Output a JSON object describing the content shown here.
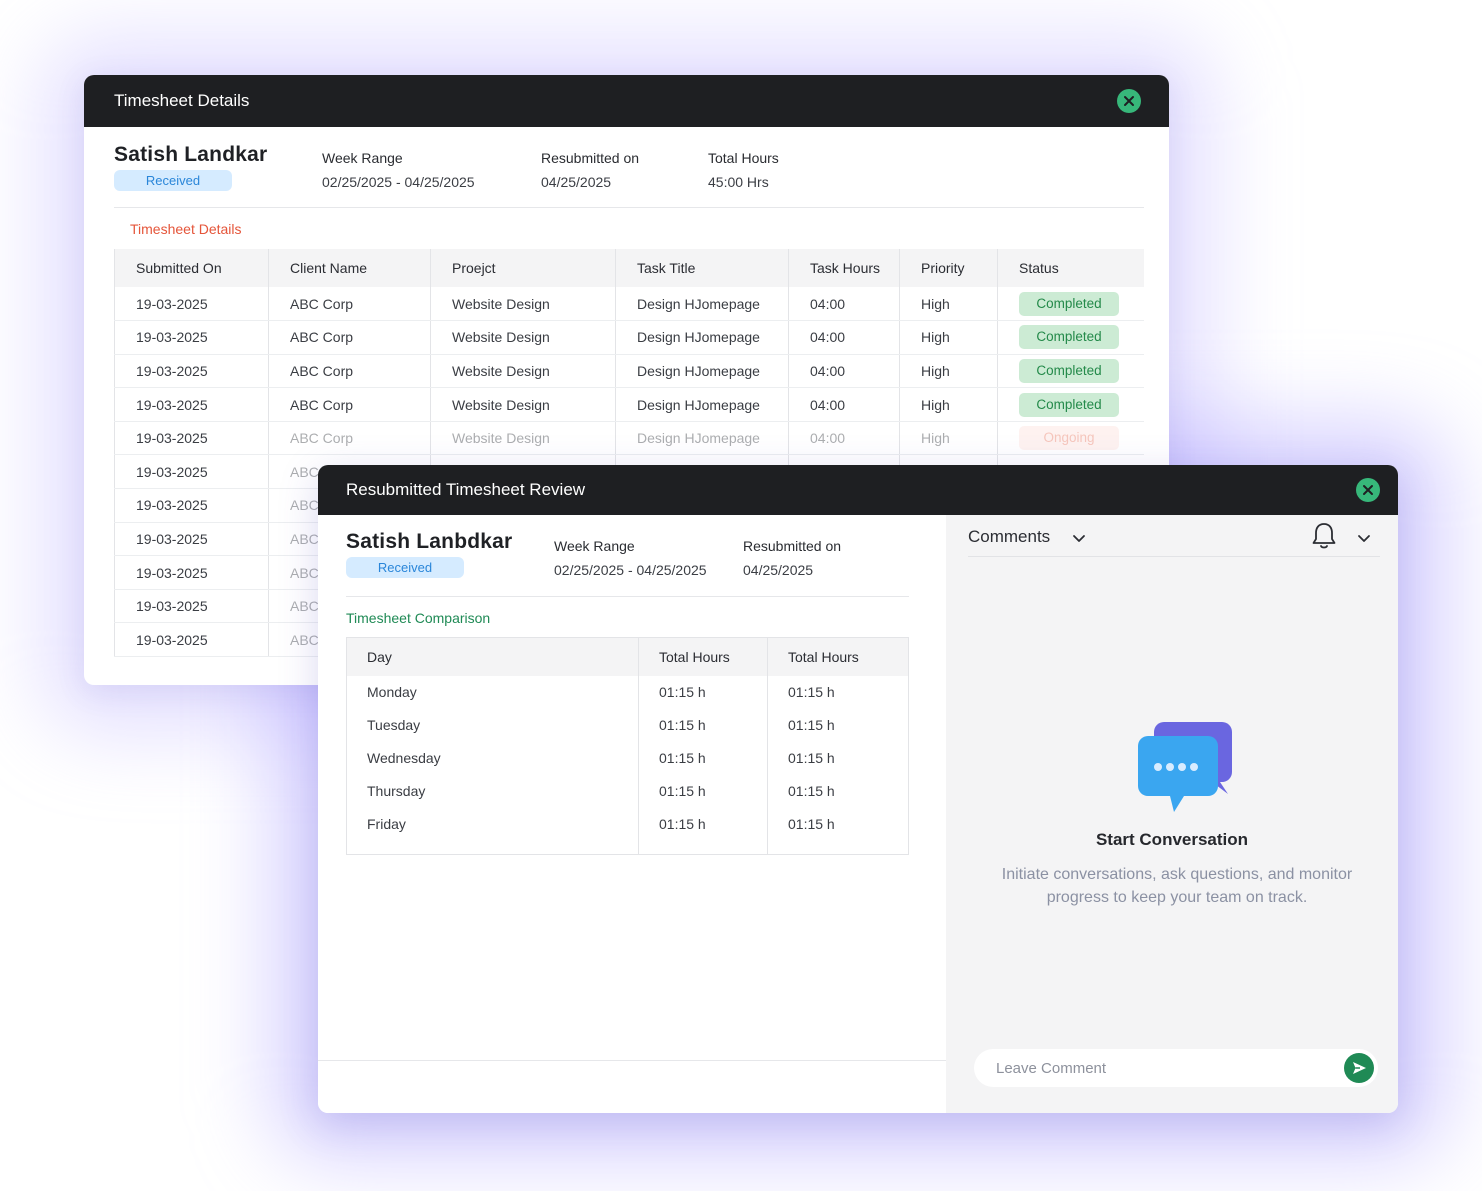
{
  "colors": {
    "titlebar": "#1e1f22",
    "close_button": "#37b77a",
    "received_badge_bg": "#d5ebff",
    "completed_badge_bg": "#ccebd4",
    "ongoing_badge_bg": "#fde1dc",
    "accent_red": "#e5553a",
    "accent_green": "#1f8a55"
  },
  "back_window": {
    "title": "Timesheet Details",
    "employee_name": "Satish Landkar",
    "status": "Received",
    "week_range_label": "Week Range",
    "week_range_value": "02/25/2025 - 04/25/2025",
    "resubmitted_label": "Resubmitted on",
    "resubmitted_value": "04/25/2025",
    "total_hours_label": "Total Hours",
    "total_hours_value": "45:00 Hrs",
    "section_title": "Timesheet Details",
    "table": {
      "headers": [
        "Submitted On",
        "Client Name",
        "Proejct",
        "Task Title",
        "Task Hours",
        "Priority",
        "Status"
      ],
      "rows": [
        [
          "19-03-2025",
          "ABC Corp",
          "Website Design",
          "Design HJomepage",
          "04:00",
          "High",
          "Completed"
        ],
        [
          "19-03-2025",
          "ABC Corp",
          "Website Design",
          "Design HJomepage",
          "04:00",
          "High",
          "Completed"
        ],
        [
          "19-03-2025",
          "ABC Corp",
          "Website Design",
          "Design HJomepage",
          "04:00",
          "High",
          "Completed"
        ],
        [
          "19-03-2025",
          "ABC Corp",
          "Website Design",
          "Design HJomepage",
          "04:00",
          "High",
          "Completed"
        ],
        [
          "19-03-2025",
          "ABC Corp",
          "Website Design",
          "Design HJomepage",
          "04:00",
          "High",
          "Ongoing"
        ],
        [
          "19-03-2025",
          "ABC",
          "",
          "",
          "",
          "",
          ""
        ],
        [
          "19-03-2025",
          "ABC",
          "",
          "",
          "",
          "",
          ""
        ],
        [
          "19-03-2025",
          "ABC",
          "",
          "",
          "",
          "",
          ""
        ],
        [
          "19-03-2025",
          "ABC",
          "",
          "",
          "",
          "",
          ""
        ],
        [
          "19-03-2025",
          "ABC",
          "",
          "",
          "",
          "",
          ""
        ],
        [
          "19-03-2025",
          "ABC",
          "",
          "",
          "",
          "",
          ""
        ]
      ]
    }
  },
  "front_window": {
    "title": "Resubmitted Timesheet Review",
    "employee_name": "Satish Lanbdkar",
    "status": "Received",
    "week_range_label": "Week Range",
    "week_range_value": "02/25/2025 - 04/25/2025",
    "resubmitted_label": "Resubmitted on",
    "resubmitted_value": "04/25/2025",
    "section_title": "Timesheet Comparison",
    "table": {
      "headers": [
        "Day",
        "Total Hours",
        "Total Hours"
      ],
      "rows": [
        [
          "Monday",
          "01:15 h",
          "01:15 h"
        ],
        [
          "Tuesday",
          "01:15 h",
          "01:15 h"
        ],
        [
          "Wednesday",
          "01:15 h",
          "01:15 h"
        ],
        [
          "Thursday",
          "01:15 h",
          "01:15 h"
        ],
        [
          "Friday",
          "01:15 h",
          "01:15 h"
        ]
      ]
    },
    "comments": {
      "label": "Comments",
      "empty_title": "Start Conversation",
      "empty_description": "Initiate conversations, ask questions, and monitor progress to keep your team on track.",
      "input_placeholder": "Leave Comment",
      "icons": [
        "chevron-down-icon",
        "bell-icon",
        "chat-bubbles-icon",
        "send-icon",
        "close-icon"
      ]
    }
  }
}
